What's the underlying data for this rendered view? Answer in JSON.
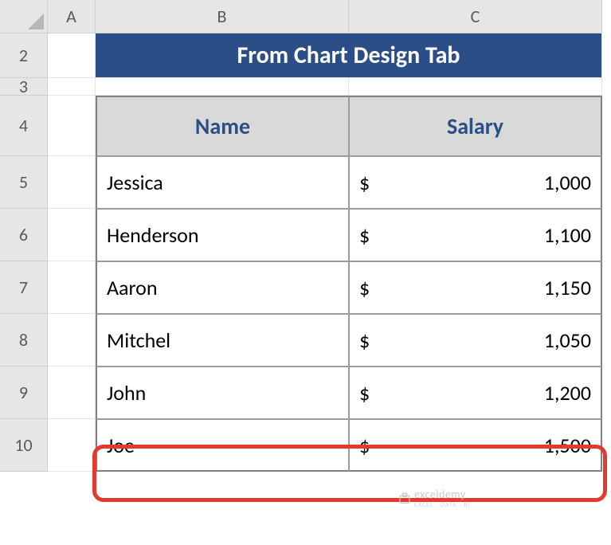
{
  "columns": [
    "A",
    "B",
    "C"
  ],
  "rows": [
    "2",
    "3",
    "4",
    "5",
    "6",
    "7",
    "8",
    "9",
    "10"
  ],
  "banner": "From Chart Design Tab",
  "table": {
    "headers": {
      "name": "Name",
      "salary": "Salary"
    },
    "currency": "$",
    "data": [
      {
        "name": "Jessica",
        "salary": "1,000"
      },
      {
        "name": "Henderson",
        "salary": "1,100"
      },
      {
        "name": "Aaron",
        "salary": "1,150"
      },
      {
        "name": "Mitchel",
        "salary": "1,050"
      },
      {
        "name": "John",
        "salary": "1,200"
      },
      {
        "name": "Joe",
        "salary": "1,500"
      }
    ]
  },
  "watermark": {
    "main": "exceldemy",
    "sub": "EXCEL · DATA · BI"
  }
}
